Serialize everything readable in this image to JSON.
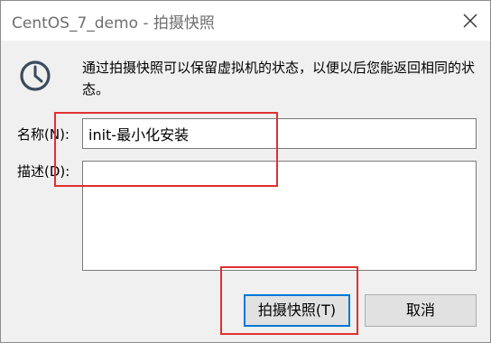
{
  "window": {
    "title": "CentOS_7_demo - 拍摄快照"
  },
  "icons": {
    "clock": "clock-icon",
    "close": "close-icon"
  },
  "message": "通过拍摄快照可以保留虚拟机的状态，以便以后您能返回相同的状态。",
  "form": {
    "name_label": "名称(N):",
    "name_value": "init-最小化安装",
    "description_label": "描述(D):",
    "description_value": ""
  },
  "buttons": {
    "snapshot_label": "拍摄快照(T)",
    "cancel_label": "取消"
  },
  "colors": {
    "highlight": "#e03030",
    "focus_border": "#0078d7"
  }
}
